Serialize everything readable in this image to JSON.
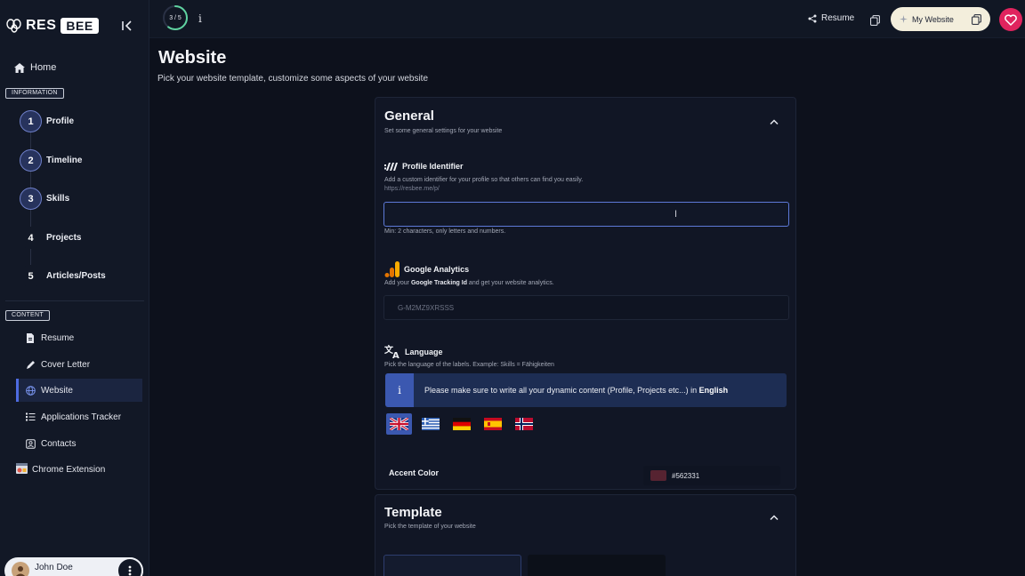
{
  "app": {
    "logo_res": "RES",
    "logo_bee": "BEE"
  },
  "sidebar": {
    "home_label": "Home",
    "information_badge": "INFORMATION",
    "steps": [
      {
        "num": "1",
        "label": "Profile",
        "done": true
      },
      {
        "num": "2",
        "label": "Timeline",
        "done": true
      },
      {
        "num": "3",
        "label": "Skills",
        "done": true
      },
      {
        "num": "4",
        "label": "Projects",
        "done": false
      },
      {
        "num": "5",
        "label": "Articles/Posts",
        "done": false
      }
    ],
    "content_badge": "CONTENT",
    "content_items": [
      {
        "label": "Resume",
        "icon": "document-icon"
      },
      {
        "label": "Cover Letter",
        "icon": "pen-icon"
      },
      {
        "label": "Website",
        "icon": "globe-icon",
        "active": true
      },
      {
        "label": "Applications Tracker",
        "icon": "list-icon"
      },
      {
        "label": "Contacts",
        "icon": "contacts-icon"
      }
    ],
    "chrome_extension_label": "Chrome Extension",
    "user_name": "John Doe"
  },
  "topbar": {
    "progress_text": "3 / 5",
    "progress_fraction": 0.6,
    "resume_label": "Resume",
    "my_website_label": "My Website"
  },
  "main": {
    "title": "Website",
    "subtitle": "Pick your website template, customize some aspects of your website"
  },
  "general": {
    "title": "General",
    "subtitle": "Set some general settings for your website",
    "profile_identifier": {
      "label": "Profile Identifier",
      "description": "Add a custom identifier for your profile so that others can find you easily.",
      "url_prefix": "https://resbee.me/p/",
      "value": "",
      "hint": "Min: 2 characters, only letters and numbers."
    },
    "google_analytics": {
      "label": "Google Analytics",
      "desc_pre": "Add your ",
      "desc_bold": "Google Tracking Id",
      "desc_post": " and get your website analytics.",
      "placeholder": "G-M2MZ9XRSSS"
    },
    "language": {
      "label": "Language",
      "description": "Pick the language of the labels. Example: Skills = Fähigkeiten",
      "banner_text": "Please make sure to write all your dynamic content (Profile, Projects etc...) in ",
      "banner_bold": "English",
      "flags": [
        "uk-flag",
        "greece-flag",
        "germany-flag",
        "spain-flag",
        "norway-flag"
      ],
      "selected": "uk-flag"
    },
    "accent_color": {
      "label": "Accent Color",
      "value": "#562331",
      "swatch": "#562331"
    }
  },
  "template": {
    "title": "Template",
    "subtitle": "Pick the template of your website"
  }
}
